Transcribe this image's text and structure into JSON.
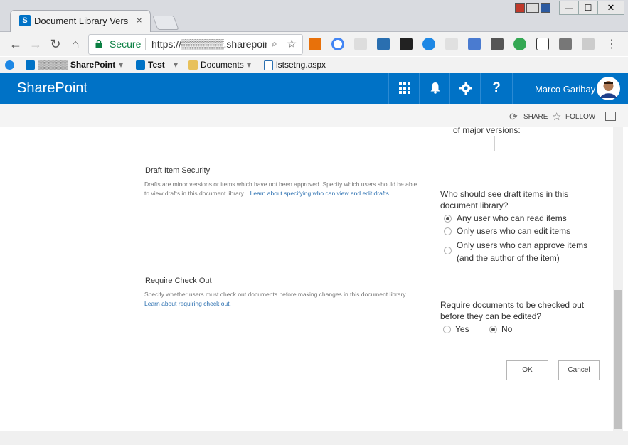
{
  "browser": {
    "tab_title": "Document Library Versio",
    "tab_close": "×",
    "window_controls": {
      "minimize": "—",
      "maximize": "☐",
      "close": "✕"
    },
    "secure_label": "Secure",
    "url": "https://▒▒▒▒▒▒.sharepoint.c",
    "nav": {
      "back": "←",
      "forward": "→",
      "reload": "↻",
      "home": "⌂"
    },
    "zoom_icon": "⌕",
    "star_icon": "☆",
    "menu": "⋮",
    "bookmarks": [
      {
        "label": "▒▒▒▒▒ SharePoint",
        "icon": "sharepoint-icon",
        "dropdown": "▾"
      },
      {
        "label": "Test",
        "icon": "sharepoint-icon",
        "dropdown": "▾"
      },
      {
        "label": "Documents",
        "icon": "folder-icon",
        "dropdown": "▾"
      },
      {
        "label": "lstsetng.aspx",
        "icon": "page-icon"
      }
    ],
    "colors": {
      "secure_green": "#0b8043",
      "chrome_gray": "#f2f2f2"
    }
  },
  "suite_bar": {
    "brand": "SharePoint",
    "app_launcher_icon": "waffle-icon",
    "bell_icon": "bell-icon",
    "settings_icon": "gear-icon",
    "help": "?",
    "user_name": "Marco Garibay",
    "color": "#0072c6"
  },
  "action_bar": {
    "share": "SHARE",
    "follow": "FOLLOW"
  },
  "content": {
    "top_fragment": "of major versions:",
    "draft_security": {
      "title": "Draft Item Security",
      "description": "Drafts are minor versions or items which have not been approved. Specify which users should be able to view drafts in this document library.",
      "link": "Learn about specifying who can view and edit drafts.",
      "question": "Who should see draft items in this document library?",
      "options": [
        {
          "label": "Any user who can read items",
          "selected": true
        },
        {
          "label": "Only users who can edit items",
          "selected": false
        },
        {
          "label": "Only users who can approve items (and the author of the item)",
          "selected": false
        }
      ]
    },
    "require_checkout": {
      "title": "Require Check Out",
      "description": "Specify whether users must check out documents before making changes in this document library.",
      "link": "Learn about requiring check out.",
      "question": "Require documents to be checked out before they can be edited?",
      "options": [
        {
          "label": "Yes",
          "selected": false
        },
        {
          "label": "No",
          "selected": true
        }
      ]
    },
    "buttons": {
      "ok": "OK",
      "cancel": "Cancel"
    }
  }
}
